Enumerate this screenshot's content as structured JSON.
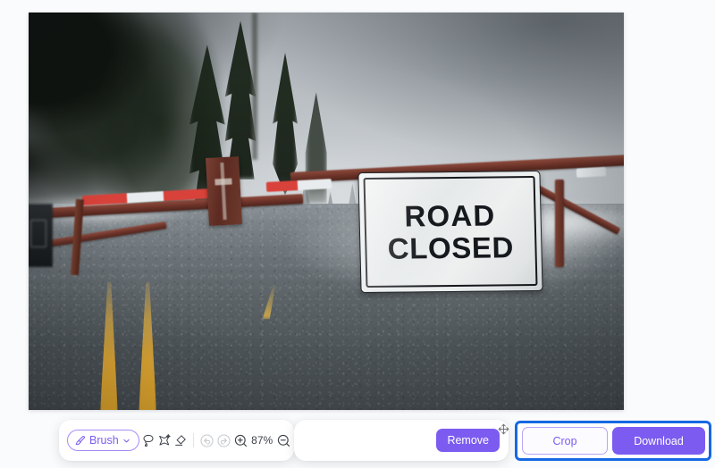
{
  "app": {
    "background_color": "#fafbfc",
    "accent_color": "#7c5cf0",
    "selection_highlight_color": "#1668e3"
  },
  "canvas": {
    "name": "image-editing-canvas",
    "photo": {
      "description": "Mountain road blocked by a red-and-white striped barrier gate in foggy winter weather",
      "sign_line_1": "ROAD",
      "sign_line_2": "CLOSED"
    }
  },
  "toolbar": {
    "brush": {
      "label": "Brush",
      "chevron": "chevron-down-icon",
      "active": true
    },
    "tools": [
      {
        "name": "lasso-tool",
        "icon": "lasso-icon"
      },
      {
        "name": "magic-select-tool",
        "icon": "magic-wand-icon"
      },
      {
        "name": "eraser-tool",
        "icon": "eraser-icon"
      }
    ],
    "history": [
      {
        "name": "undo-button",
        "icon": "undo-icon",
        "disabled": true
      },
      {
        "name": "redo-button",
        "icon": "redo-icon",
        "disabled": true
      }
    ],
    "zoom": {
      "in_icon": "zoom-in-icon",
      "out_icon": "zoom-out-icon",
      "level": "87%"
    },
    "pan": {
      "name": "pan-tool",
      "icon": "hand-icon"
    }
  },
  "actions": {
    "remove_label": "Remove",
    "move_handle_icon": "move-icon",
    "crop_label": "Crop",
    "download_label": "Download"
  }
}
